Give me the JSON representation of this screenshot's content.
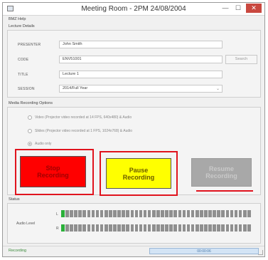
{
  "window": {
    "title": "Meeting Room - 2PM 24/08/2004",
    "minimize_glyph": "—",
    "maximize_glyph": "☐",
    "close_glyph": "✕"
  },
  "menu": {
    "help": "BMZ Help"
  },
  "lecture_details": {
    "heading": "Lecture Details",
    "presenter_label": "PRESENTER",
    "presenter_value": "John Smith",
    "code_label": "CODE",
    "code_value": "ENV51001",
    "search_label": "Search",
    "title_label": "TITLE",
    "title_value": "Lecture 1",
    "session_label": "SESSION",
    "session_value": "2014/Full Year"
  },
  "recording_options": {
    "heading": "Media Recording Options",
    "option_video": "Video (Projector video recorded at 14 FPS, 640x480) & Audio",
    "option_slides": "Slides (Projector video recorded at 1 FPS, 1024x768) & Audio",
    "option_audio": "Audio only"
  },
  "buttons": {
    "stop_line1": "Stop",
    "stop_line2": "Recording",
    "pause_line1": "Pause",
    "pause_line2": "Recording",
    "resume_line1": "Resume",
    "resume_line2": "Recording"
  },
  "status": {
    "heading": "Status",
    "audio_level_label": "Audio Level",
    "left_channel": "L",
    "right_channel": "R",
    "left_level": 0.03,
    "right_level": 0.03
  },
  "statusbar": {
    "state": "Recording",
    "elapsed": "00:00:06"
  },
  "colors": {
    "stop": "#ff0000",
    "pause": "#ffff00",
    "resume_disabled": "#a8a8a8",
    "highlight": "#e0141e",
    "meter_active": "#2bb03a",
    "meter_idle": "#8f8f8f"
  },
  "icons": {
    "app": "window-app-icon",
    "dropdown": "chevron-down-icon"
  }
}
